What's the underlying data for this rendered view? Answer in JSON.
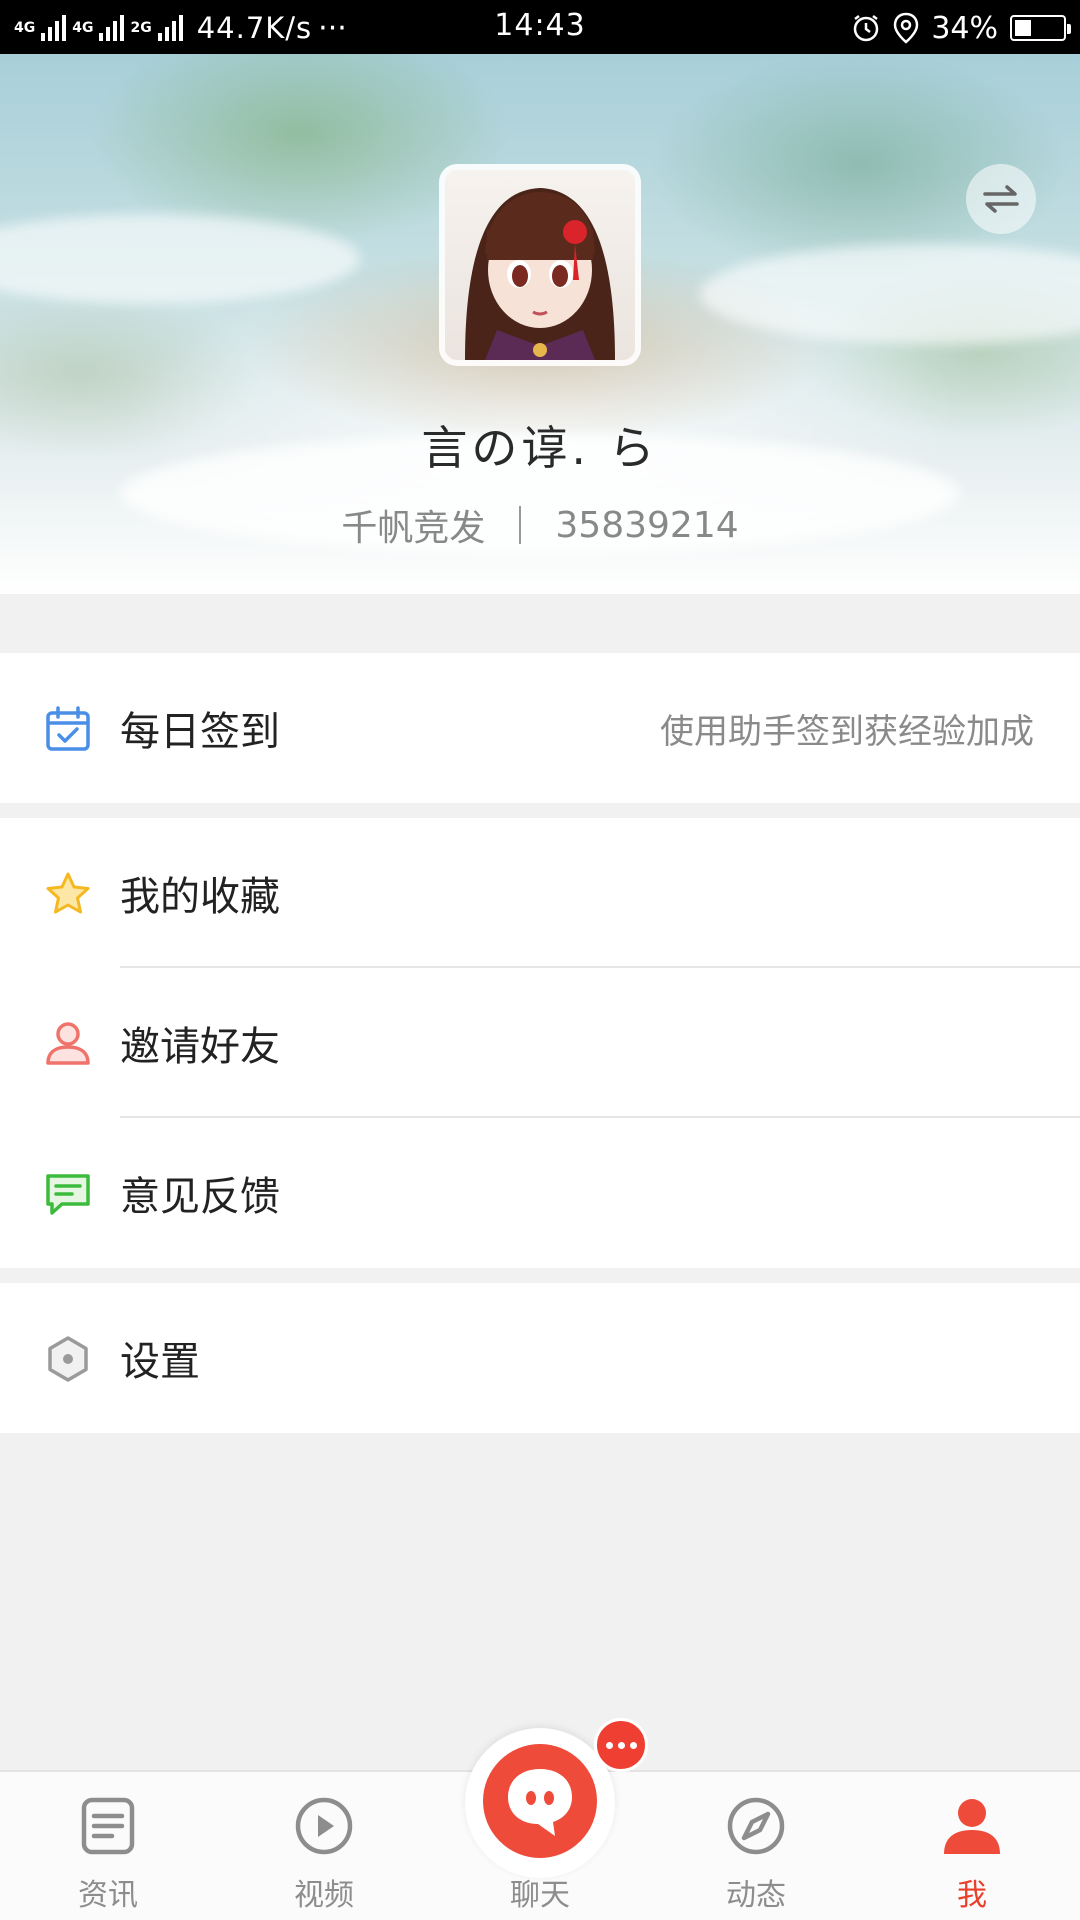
{
  "status_bar": {
    "network_1": "4G",
    "network_2": "4G",
    "network_3": "2G",
    "speed": "44.7K/s",
    "more": "···",
    "time": "14:43",
    "battery": "34%",
    "battery_level": 0.34
  },
  "profile": {
    "username": "言の谆. ら",
    "server": "千帆竞发",
    "user_id": "35839214"
  },
  "menu": {
    "sign_in": {
      "label": "每日签到",
      "hint": "使用助手签到获经验加成",
      "icon": "calendar-check-icon",
      "color": "#4a8fe7"
    },
    "favorites": {
      "label": "我的收藏",
      "icon": "star-icon",
      "color": "#f5b820"
    },
    "invite": {
      "label": "邀请好友",
      "icon": "user-icon",
      "color": "#f0736b"
    },
    "feedback": {
      "label": "意见反馈",
      "icon": "message-icon",
      "color": "#3cbb3c"
    },
    "settings": {
      "label": "设置",
      "icon": "hexagon-gear-icon",
      "color": "#9a9a9a"
    }
  },
  "tabs": [
    {
      "label": "资讯",
      "icon": "news-icon",
      "active": false
    },
    {
      "label": "视频",
      "icon": "play-icon",
      "active": false
    },
    {
      "label": "聊天",
      "icon": "chat-icon",
      "active": false
    },
    {
      "label": "动态",
      "icon": "compass-icon",
      "active": false
    },
    {
      "label": "我",
      "icon": "user-icon",
      "active": true
    }
  ],
  "colors": {
    "accent": "#e8402b",
    "tab_inactive": "#8d8d8d",
    "background": "#f1f1f1"
  }
}
